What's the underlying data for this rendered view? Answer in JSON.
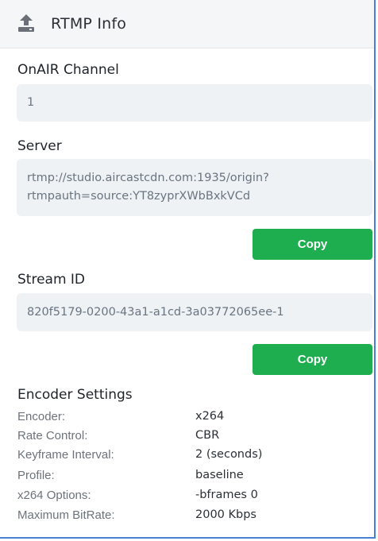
{
  "header": {
    "title": "RTMP Info",
    "icon": "upload-icon"
  },
  "onair": {
    "label": "OnAIR Channel",
    "value": "1"
  },
  "server": {
    "label": "Server",
    "value_line1": "rtmp://studio.aircastcdn.com:1935/origin?",
    "value_line2": "rtmpauth=source:YT8zyprXWbBxkVCd",
    "copy_label": "Copy"
  },
  "stream": {
    "label": "Stream ID",
    "value": "820f5179-0200-43a1-a1cd-3a03772065ee-1",
    "copy_label": "Copy"
  },
  "encoder": {
    "title": "Encoder Settings",
    "rows": [
      {
        "key": "Encoder:",
        "value": "x264"
      },
      {
        "key": "Rate Control:",
        "value": "CBR"
      },
      {
        "key": "Keyframe Interval:",
        "value": "2 (seconds)"
      },
      {
        "key": "Profile:",
        "value": "baseline"
      },
      {
        "key": "x264 Options:",
        "value": "-bframes 0"
      },
      {
        "key": "Maximum BitRate:",
        "value": "2000 Kbps"
      }
    ]
  },
  "colors": {
    "accent_border": "#4a7fd6",
    "copy_button": "#1fae4f",
    "field_bg": "#eef2f5"
  }
}
